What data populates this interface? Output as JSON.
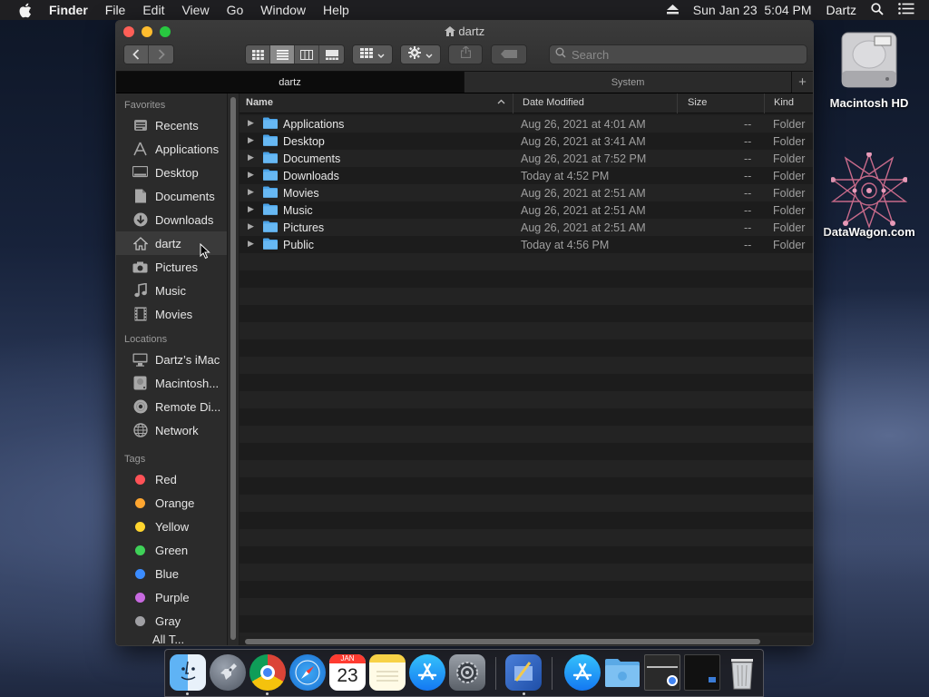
{
  "menubar": {
    "app_name": "Finder",
    "menus": [
      "File",
      "Edit",
      "View",
      "Go",
      "Window",
      "Help"
    ],
    "datetime": "Sun Jan 23  5:04 PM",
    "user": "Dartz",
    "icons": [
      "apple-icon",
      "eject-icon",
      "spotlight-search-icon",
      "notification-center-icon"
    ]
  },
  "desktop": {
    "icons": [
      {
        "label": "Macintosh HD",
        "icon": "hard-drive-icon"
      },
      {
        "label": "DataWagon.com",
        "icon": "geometric-star-logo-icon"
      }
    ]
  },
  "window": {
    "title": "dartz",
    "search": {
      "placeholder": "Search",
      "value": ""
    },
    "tabs": [
      {
        "label": "dartz",
        "active": true
      },
      {
        "label": "System",
        "active": false
      }
    ],
    "add_tab": "+"
  },
  "sidebar": {
    "favorites_header": "Favorites",
    "favorites": [
      {
        "label": "Recents",
        "icon": "clock-icon"
      },
      {
        "label": "Applications",
        "icon": "applications-icon"
      },
      {
        "label": "Desktop",
        "icon": "desktop-icon"
      },
      {
        "label": "Documents",
        "icon": "document-icon"
      },
      {
        "label": "Downloads",
        "icon": "download-icon"
      },
      {
        "label": "dartz",
        "icon": "home-icon",
        "selected": true
      },
      {
        "label": "Pictures",
        "icon": "camera-icon"
      },
      {
        "label": "Music",
        "icon": "music-note-icon"
      },
      {
        "label": "Movies",
        "icon": "film-icon"
      }
    ],
    "locations_header": "Locations",
    "locations": [
      {
        "label": "Dartz’s iMac",
        "icon": "imac-icon"
      },
      {
        "label": "Macintosh...",
        "icon": "hard-drive-icon"
      },
      {
        "label": "Remote Di...",
        "icon": "disc-icon"
      },
      {
        "label": "Network",
        "icon": "globe-icon"
      }
    ],
    "tags_header": "Tags",
    "tags": [
      {
        "label": "Red",
        "color": "#ff5257"
      },
      {
        "label": "Orange",
        "color": "#ffa630"
      },
      {
        "label": "Yellow",
        "color": "#ffd52e"
      },
      {
        "label": "Green",
        "color": "#3fd158"
      },
      {
        "label": "Blue",
        "color": "#3b8cff"
      },
      {
        "label": "Purple",
        "color": "#c86ae0"
      },
      {
        "label": "Gray",
        "color": "#a0a0a4"
      }
    ],
    "partial_item": "All T..."
  },
  "list": {
    "columns": {
      "name": "Name",
      "date": "Date Modified",
      "size": "Size",
      "kind": "Kind"
    },
    "rows": [
      {
        "name": "Applications",
        "date": "Aug 26, 2021 at 4:01 AM",
        "size": "--",
        "kind": "Folder"
      },
      {
        "name": "Desktop",
        "date": "Aug 26, 2021 at 3:41 AM",
        "size": "--",
        "kind": "Folder"
      },
      {
        "name": "Documents",
        "date": "Aug 26, 2021 at 7:52 PM",
        "size": "--",
        "kind": "Folder"
      },
      {
        "name": "Downloads",
        "date": "Today at 4:52 PM",
        "size": "--",
        "kind": "Folder"
      },
      {
        "name": "Movies",
        "date": "Aug 26, 2021 at 2:51 AM",
        "size": "--",
        "kind": "Folder"
      },
      {
        "name": "Music",
        "date": "Aug 26, 2021 at 2:51 AM",
        "size": "--",
        "kind": "Folder"
      },
      {
        "name": "Pictures",
        "date": "Aug 26, 2021 at 2:51 AM",
        "size": "--",
        "kind": "Folder"
      },
      {
        "name": "Public",
        "date": "Today at 4:56 PM",
        "size": "--",
        "kind": "Folder"
      }
    ]
  },
  "dock": {
    "calendar_month": "JAN",
    "calendar_day": "23",
    "apps": [
      "finder-icon",
      "launchpad-icon",
      "chrome-icon",
      "safari-icon",
      "calendar-icon",
      "notes-icon",
      "app-store-icon",
      "system-preferences-icon",
      "xcode-instruments-icon",
      "app-store-icon",
      "folder-icon",
      "chrome-window-icon",
      "screen-window-icon",
      "trash-icon"
    ]
  }
}
